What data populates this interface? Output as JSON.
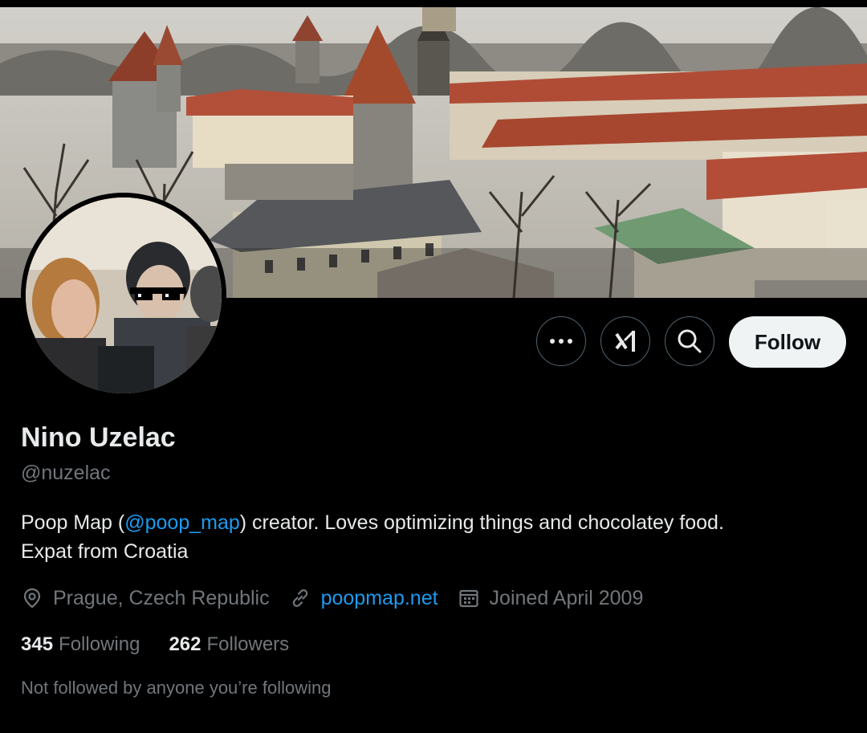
{
  "profile": {
    "name": "Nino Uzelac",
    "handle": "@nuzelac",
    "bio_before": "Poop Map (",
    "bio_mention": "@poop_map",
    "bio_after": ") creator. Loves optimizing things and chocolatey food.",
    "bio_line2": "Expat from Croatia",
    "location": "Prague, Czech Republic",
    "website": "poopmap.net",
    "joined": "Joined April 2009",
    "following_count": "345",
    "following_label": "Following",
    "followers_count": "262",
    "followers_label": "Followers",
    "mutuals_note": "Not followed by anyone you’re following"
  },
  "actions": {
    "follow_label": "Follow",
    "more_icon": "more-icon",
    "grok_icon": "grok-icon",
    "search_icon": "search-icon"
  },
  "colors": {
    "background": "#000000",
    "text_primary": "#e7e9ea",
    "text_secondary": "#71767b",
    "link": "#1d9bf0",
    "follow_button": "#eff3f4"
  }
}
